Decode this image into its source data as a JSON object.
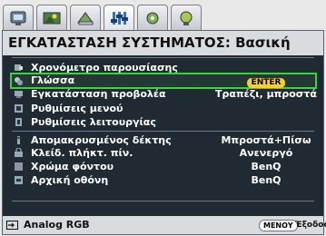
{
  "tabs": [
    {
      "icon": "display-icon"
    },
    {
      "icon": "picture-icon"
    },
    {
      "icon": "image-settings-icon"
    },
    {
      "icon": "system-setup-icon"
    },
    {
      "icon": "advanced-setup-icon"
    },
    {
      "icon": "information-icon"
    }
  ],
  "active_tab_index": 3,
  "menu": {
    "title": "ΕΓΚΑΤΑΣΤΑΣΗ ΣΥΣΤΗΜΑΤΟΣ: Βασική",
    "items": [
      {
        "icon": "timer-icon",
        "label": "Χρονόμετρο παρουσίασης",
        "value": ""
      },
      {
        "icon": "language-icon",
        "label": "Γλώσσα",
        "value": "ENTER"
      },
      {
        "icon": "projector-icon",
        "label": "Εγκατάσταση προβολέα",
        "value": "Τραπέζι, μπροστά"
      },
      {
        "icon": "menu-settings-icon",
        "label": "Ρυθμίσεις μενού",
        "value": ""
      },
      {
        "icon": "operation-settings-icon",
        "label": "Ρυθμίσεις λειτουργίας",
        "value": ""
      },
      {
        "icon": "remote-receiver-icon",
        "label": "Απομακρυσμένος δέκτης",
        "value": "Μπροστά+Πίσω"
      },
      {
        "icon": "keypad-lock-icon",
        "label": "Κλείδ. πλήκτ. πίν.",
        "value": "Ανενεργό"
      },
      {
        "icon": "background-color-icon",
        "label": "Χρώμα φόντου",
        "value": "BenQ"
      },
      {
        "icon": "splash-screen-icon",
        "label": "Αρχική οθόνη",
        "value": "BenQ"
      }
    ],
    "selected_index": 1
  },
  "footer": {
    "source_icon": "input-source-icon",
    "source": "Analog RGB",
    "menu_key": "ΜΕΝΟΥ",
    "exit": "Έξοδος"
  },
  "colors": {
    "panel_bg": "#1f2a33",
    "selection_border": "#37d43a",
    "enter_badge": "#f3d22a"
  }
}
